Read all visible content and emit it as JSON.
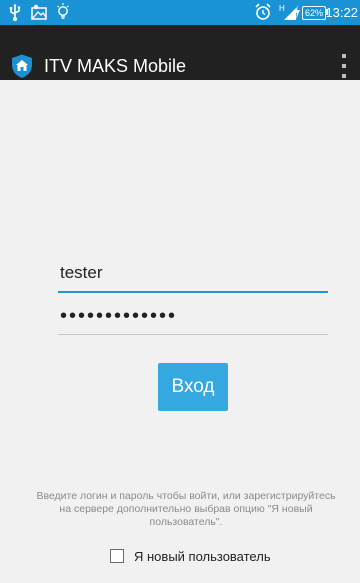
{
  "status_bar": {
    "icons": [
      "usb-icon",
      "image-icon",
      "bulb-icon",
      "alarm-icon",
      "signal-icon",
      "charging-icon"
    ],
    "signal_label": "H",
    "battery_percent": "62%",
    "time": "13:22",
    "color": "#1a93d6"
  },
  "action_bar": {
    "title": "ITV MAKS Mobile",
    "app_icon": "shield-home-icon",
    "menu_icon": "overflow-menu-icon",
    "color": "#212121"
  },
  "form": {
    "login_value": "tester",
    "password_value": "•••••••••••••",
    "login_button_label": "Вход",
    "accent_color": "#2196d3",
    "button_color": "#35a8e0"
  },
  "hint_text": "Введите логин и пароль чтобы войти, или зарегистрируйтесь на сервере дополнительно выбрав опцию \"Я новый пользователь\".",
  "new_user": {
    "label": "Я новый пользователь",
    "checked": false
  }
}
